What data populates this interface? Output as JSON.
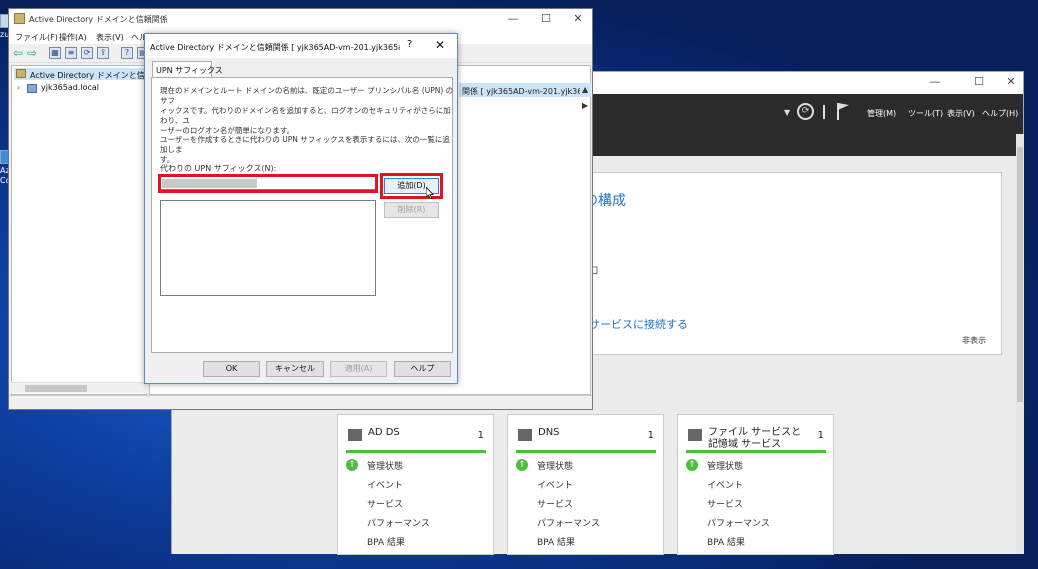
{
  "desktop": {
    "icon_label_1": "zur",
    "icon_label_2": "Azu",
    "icon_label_3": "Co"
  },
  "server_manager": {
    "menus": [
      "管理(M)",
      "ツール(T)",
      "表示(V)",
      "ヘルプ(H)"
    ],
    "welcome_heading_partial": "の構成",
    "welcome_item_partial": "ロ",
    "cloud_link_partial": "サービスに接続する",
    "hide_label": "非表示",
    "tiles": [
      {
        "title": "AD DS",
        "count": "1",
        "rows": [
          "管理状態",
          "イベント",
          "サービス",
          "パフォーマンス",
          "BPA 結果"
        ]
      },
      {
        "title": "DNS",
        "count": "1",
        "rows": [
          "管理状態",
          "イベント",
          "サービス",
          "パフォーマンス",
          "BPA 結果"
        ]
      },
      {
        "title": "ファイル サービスと記憶域 サービス",
        "count": "1",
        "rows": [
          "管理状態",
          "イベント",
          "サービス",
          "パフォーマンス",
          "BPA 結果"
        ]
      }
    ]
  },
  "ad_window": {
    "title": "Active Directory ドメインと信頼関係",
    "menus": [
      "ファイル(F)",
      "操作(A)",
      "表示(V)",
      "ヘルプ"
    ],
    "tree_root": "Active Directory ドメインと信頼関係",
    "tree_child": "yjk365ad.local",
    "list_header": "関係 [ yjk365AD-vm-201.yjk36..."
  },
  "dialog": {
    "title": "Active Directory ドメインと信頼関係 [ yjk365AD-vm-201.yjk365ad.loc...",
    "help_glyph": "?",
    "close_glyph": "✕",
    "tab_label": "UPN サフィックス",
    "description_lines": [
      "現在のドメインとルート ドメインの名前は、既定のユーザー プリンシパル名 (UPN) のサフ",
      "ィックスです。代わりのドメイン名を追加すると、ログオンのセキュリティがさらに加わり、ユ",
      "ーザーのログオン名が簡単になります。"
    ],
    "instruction_lines": [
      "ユーザーを作成するときに代わりの UPN サフィックスを表示するには、次の一覧に追加しま",
      "す。"
    ],
    "field_label": "代わりの UPN サフィックス(N):",
    "add_button": "追加(D)",
    "remove_button": "削除(R)",
    "ok_button": "OK",
    "cancel_button": "キャンセル",
    "apply_button": "適用(A)",
    "help_button": "ヘルプ"
  }
}
